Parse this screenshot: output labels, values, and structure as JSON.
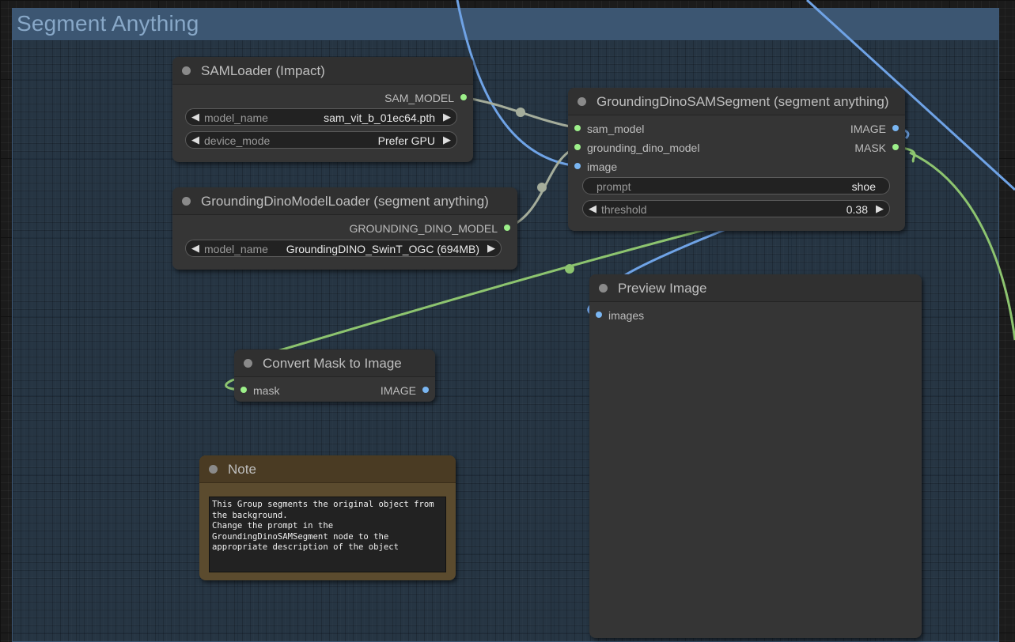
{
  "group": {
    "title": "Segment Anything"
  },
  "colors": {
    "green_link": "#8dc46f",
    "blue_link": "#6fa3e6",
    "gray_link": "#a5ad9b",
    "group_bg": "#304a64",
    "node_bg": "#353535",
    "note_bg": "#5b4b2e"
  },
  "nodes": {
    "sam_loader": {
      "title": "SAMLoader (Impact)",
      "output": "SAM_MODEL",
      "widgets": [
        {
          "label": "model_name",
          "value": "sam_vit_b_01ec64.pth"
        },
        {
          "label": "device_mode",
          "value": "Prefer GPU"
        }
      ]
    },
    "dino_loader": {
      "title": "GroundingDinoModelLoader (segment anything)",
      "output": "GROUNDING_DINO_MODEL",
      "widgets": [
        {
          "label": "model_name",
          "value": "GroundingDINO_SwinT_OGC (694MB)"
        }
      ]
    },
    "segment": {
      "title": "GroundingDinoSAMSegment (segment anything)",
      "inputs": [
        "sam_model",
        "grounding_dino_model",
        "image"
      ],
      "outputs": [
        "IMAGE",
        "MASK"
      ],
      "widgets": [
        {
          "label": "prompt",
          "value": "shoe"
        },
        {
          "label": "threshold",
          "value": "0.38"
        }
      ]
    },
    "preview": {
      "title": "Preview Image",
      "input": "images"
    },
    "convert": {
      "title": "Convert Mask to Image",
      "input": "mask",
      "output": "IMAGE"
    },
    "note": {
      "title": "Note",
      "text": "This Group segments the original object from\nthe background.\nChange the prompt in the\nGroundingDinoSAMSegment node to the\nappropriate description of the object"
    }
  }
}
